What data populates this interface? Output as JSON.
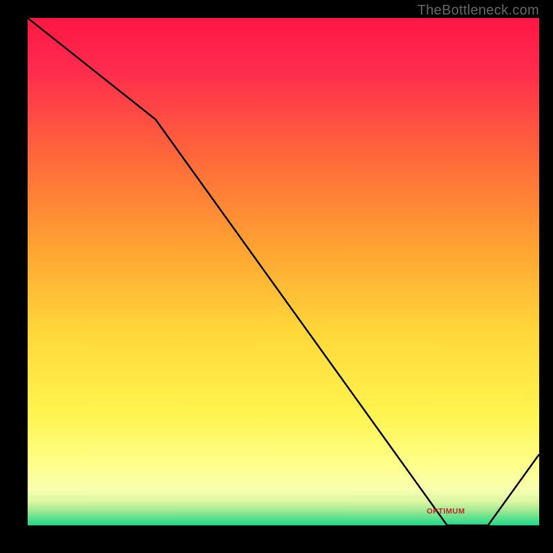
{
  "watermark": "TheBottleneck.com",
  "annotation_label": "OPTIMUM",
  "chart_data": {
    "type": "line",
    "title": "",
    "xlabel": "",
    "ylabel": "",
    "x": [
      0,
      25,
      82,
      90,
      100
    ],
    "values": [
      100,
      80,
      0,
      0,
      14
    ],
    "xlim": [
      0,
      100
    ],
    "ylim": [
      0,
      100
    ],
    "optimum_range": [
      82,
      90
    ],
    "gradient_stops": [
      {
        "pos": 0.0,
        "color": "#ff1744"
      },
      {
        "pos": 0.1,
        "color": "#ff2b4e"
      },
      {
        "pos": 0.28,
        "color": "#ff6a3a"
      },
      {
        "pos": 0.45,
        "color": "#ffa232"
      },
      {
        "pos": 0.62,
        "color": "#ffd83a"
      },
      {
        "pos": 0.78,
        "color": "#fff44f"
      },
      {
        "pos": 0.88,
        "color": "#ffff8a"
      },
      {
        "pos": 0.93,
        "color": "#f7ffb0"
      },
      {
        "pos": 0.955,
        "color": "#d8f5a0"
      },
      {
        "pos": 0.975,
        "color": "#8ee68f"
      },
      {
        "pos": 1.0,
        "color": "#1ed98a"
      }
    ]
  },
  "annotation_pos": {
    "left_pct": 78,
    "top_pct": 96.5
  }
}
